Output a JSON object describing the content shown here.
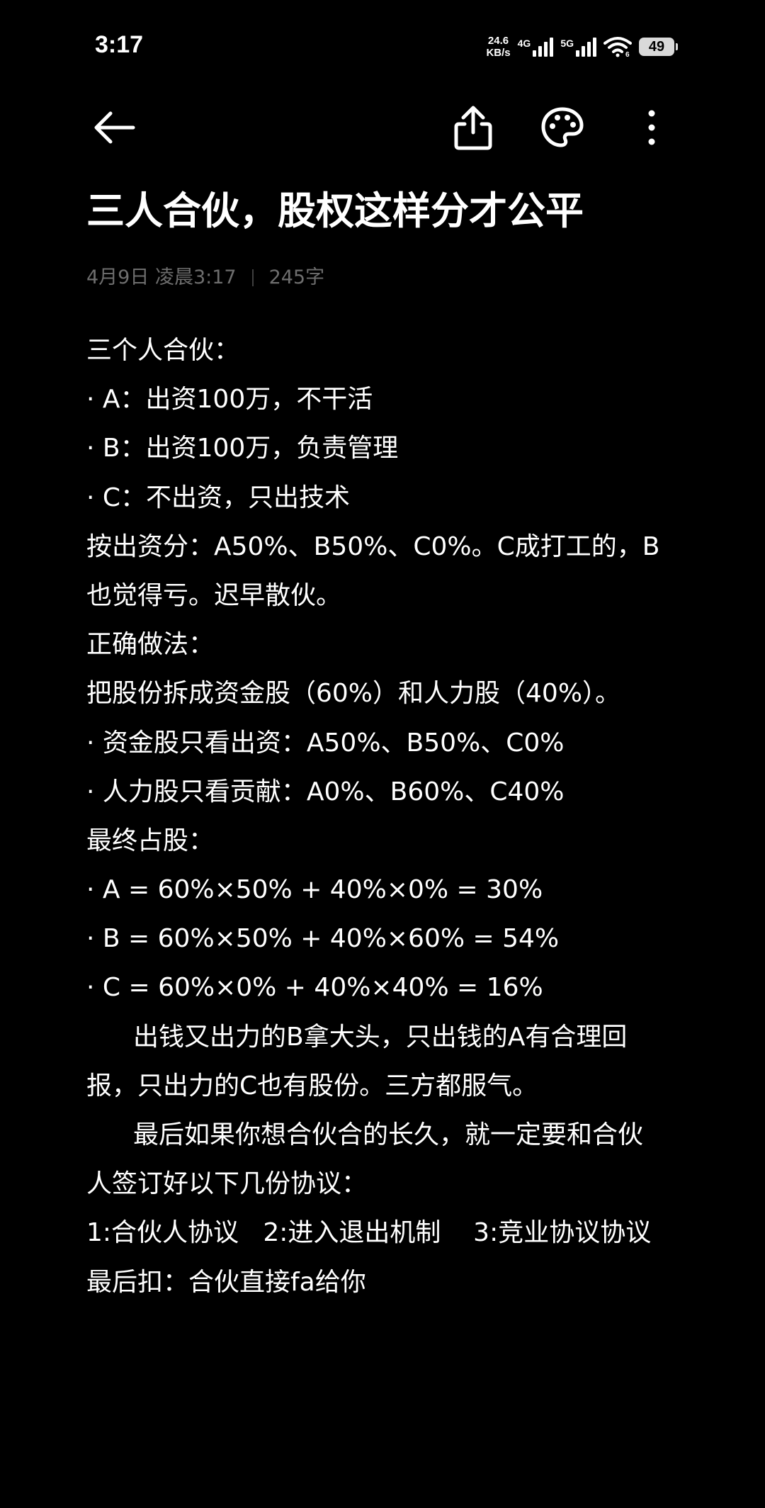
{
  "status_bar": {
    "time": "3:17",
    "net_speed_value": "24.6",
    "net_speed_unit": "KB/s",
    "sim1_label": "4G",
    "sim2_label": "5G",
    "battery_level": "49"
  },
  "toolbar": {
    "icons": [
      "back-arrow-icon",
      "share-icon",
      "palette-icon",
      "more-vertical-icon"
    ]
  },
  "note": {
    "title": "三人合伙，股权这样分才公平",
    "date": "4月9日 凌晨3:17",
    "word_count": "245字",
    "lines": [
      "三个人合伙：",
      "· A：出资100万，不干活",
      "· B：出资100万，负责管理",
      "· C：不出资，只出技术",
      "按出资分：A50%、B50%、C0%。C成打工的，B",
      "也觉得亏。迟早散伙。",
      "正确做法：",
      "把股份拆成资金股（60%）和人力股（40%）。",
      "· 资金股只看出资：A50%、B50%、C0%",
      "· 人力股只看贡献：A0%、B60%、C40%",
      "最终占股：",
      "· A = 60%×50% + 40%×0% = 30%",
      "· B = 60%×50% + 40%×60% = 54%",
      "· C = 60%×0% + 40%×40% = 16%",
      "出钱又出力的B拿大头，只出钱的A有合理回",
      "报，只出力的C也有股份。三方都服气。",
      "最后如果你想合伙合的长久，就一定要和合伙",
      "人签订好以下几份协议：",
      "1:合伙人协议   2:进入退出机制    3:竞业协议协议",
      "最后扣：合伙直接fa给你"
    ]
  }
}
